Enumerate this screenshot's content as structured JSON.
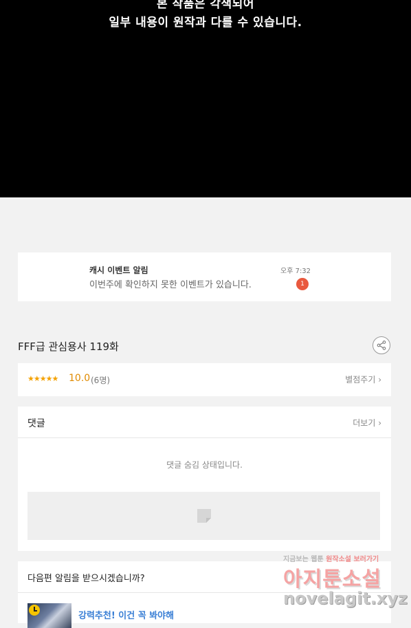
{
  "hero": {
    "line1": "본 작품은 각색되어",
    "line2": "일부 내용이 원작과 다를 수 있습니다."
  },
  "notice": {
    "title": "캐시 이벤트 알림",
    "body": "이번주에 확인하지 못한 이벤트가 있습니다.",
    "time": "오후 7:32",
    "badge": "1"
  },
  "episode": {
    "title": "FFF급 관심용사 119화"
  },
  "rating": {
    "stars": "★★★★★",
    "score": "10.0",
    "votes": "(6명)",
    "rate_label": "별점주기 ›"
  },
  "comments": {
    "title": "댓글",
    "more_label": "더보기 ›",
    "hidden_text": "댓글 숨김 상태입니다."
  },
  "next": {
    "question": "다음편 알림을 받으시겠습니까?",
    "recommend": "강력추천! 이건 꼭 봐야해"
  },
  "watermark": {
    "top_gray": "지금보는 웹툰",
    "top_red": "원작소설 보러가기",
    "main": "아지툰소설",
    "url": "novelagit.xyz"
  },
  "colors": {
    "badge": "#e9593e",
    "score": "#e08a00",
    "link": "#3a7fd5"
  }
}
